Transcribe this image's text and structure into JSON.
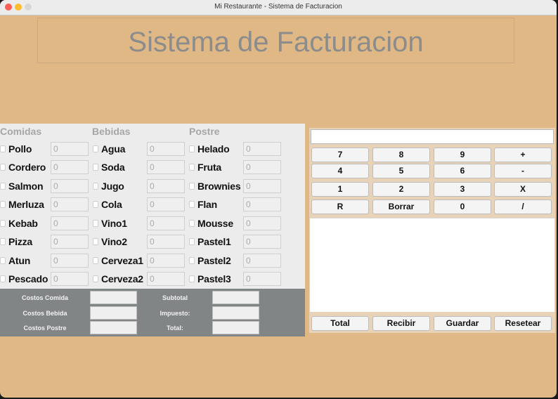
{
  "window": {
    "title": "Mi Restaurante - Sistema de Facturacion"
  },
  "banner": {
    "title": "Sistema de Facturacion"
  },
  "colors": {
    "background": "#dfb886",
    "panel": "#ececec",
    "costs_panel": "#828586",
    "title_gray": "#8c8c8c"
  },
  "menu": {
    "comidas": {
      "header": "Comidas",
      "items": [
        {
          "label": "Pollo",
          "value": "0"
        },
        {
          "label": "Cordero",
          "value": "0"
        },
        {
          "label": "Salmon",
          "value": "0"
        },
        {
          "label": "Merluza",
          "value": "0"
        },
        {
          "label": "Kebab",
          "value": "0"
        },
        {
          "label": "Pizza",
          "value": "0"
        },
        {
          "label": "Atun",
          "value": "0"
        },
        {
          "label": "Pescado",
          "value": "0"
        }
      ]
    },
    "bebidas": {
      "header": "Bebidas",
      "items": [
        {
          "label": "Agua",
          "value": "0"
        },
        {
          "label": "Soda",
          "value": "0"
        },
        {
          "label": "Jugo",
          "value": "0"
        },
        {
          "label": "Cola",
          "value": "0"
        },
        {
          "label": "Vino1",
          "value": "0"
        },
        {
          "label": "Vino2",
          "value": "0"
        },
        {
          "label": "Cerveza1",
          "value": "0"
        },
        {
          "label": "Cerveza2",
          "value": "0"
        }
      ]
    },
    "postre": {
      "header": "Postre",
      "items": [
        {
          "label": "Helado",
          "value": "0"
        },
        {
          "label": "Fruta",
          "value": "0"
        },
        {
          "label": "Brownies",
          "value": "0"
        },
        {
          "label": "Flan",
          "value": "0"
        },
        {
          "label": "Mousse",
          "value": "0"
        },
        {
          "label": "Pastel1",
          "value": "0"
        },
        {
          "label": "Pastel2",
          "value": "0"
        },
        {
          "label": "Pastel3",
          "value": "0"
        }
      ]
    }
  },
  "costs": {
    "comida": "Costos Comida",
    "bebida": "Costos Bebida",
    "postre": "Costos Postre",
    "subtotal": "Subtotal",
    "impuesto": "Impuesto:",
    "total": "Total:"
  },
  "calculator": {
    "display_value": "",
    "keys": [
      [
        "7",
        "8",
        "9",
        "+"
      ],
      [
        "4",
        "5",
        "6",
        "-"
      ],
      [
        "1",
        "2",
        "3",
        "X"
      ],
      [
        "R",
        "Borrar",
        "0",
        "/"
      ]
    ]
  },
  "receipt": {
    "text": ""
  },
  "actions": {
    "total": "Total",
    "recibir": "Recibir",
    "guardar": "Guardar",
    "resetear": "Resetear"
  }
}
